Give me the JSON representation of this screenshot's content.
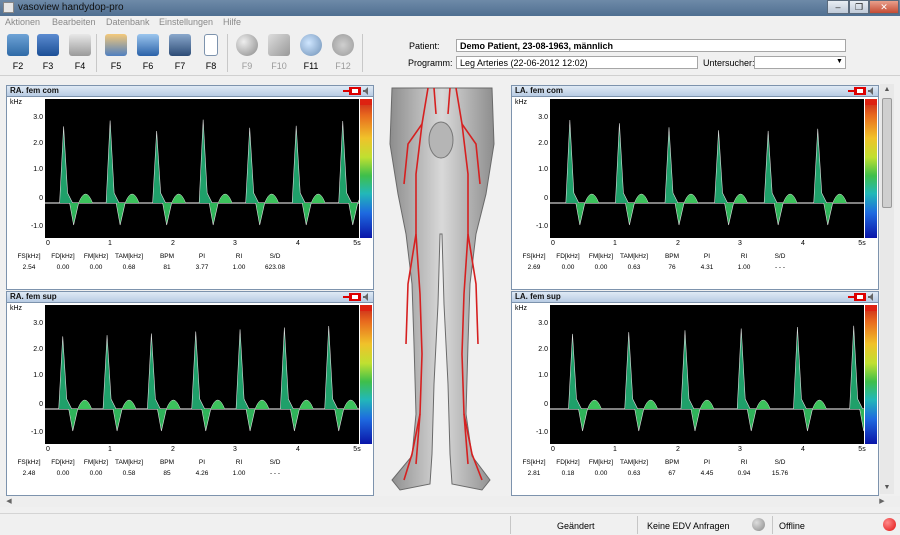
{
  "window": {
    "title": "vasoview handydop-pro",
    "min": "–",
    "max": "❐",
    "close": "✕"
  },
  "menu": [
    "Aktionen",
    "Bearbeiten",
    "Datenbank",
    "Einstellungen",
    "Hilfe"
  ],
  "toolbar": {
    "buttons": [
      {
        "label": "F2",
        "icon": "open-folder-icon",
        "enabled": true
      },
      {
        "label": "F3",
        "icon": "save-disk-icon",
        "enabled": true
      },
      {
        "label": "F4",
        "icon": "printer-icon",
        "enabled": true
      },
      {
        "label": "F5",
        "icon": "patient-icon",
        "enabled": true
      },
      {
        "label": "F6",
        "icon": "edit-record-icon",
        "enabled": true
      },
      {
        "label": "F7",
        "icon": "monitor-icon",
        "enabled": true
      },
      {
        "label": "F8",
        "icon": "document-icon",
        "enabled": true
      },
      {
        "label": "F9",
        "icon": "record-sphere-icon",
        "enabled": false
      },
      {
        "label": "F10",
        "icon": "probe-icon",
        "enabled": false
      },
      {
        "label": "F11",
        "icon": "zoom-icon",
        "enabled": true
      },
      {
        "label": "F12",
        "icon": "speaker-icon",
        "enabled": false
      }
    ],
    "patient_label": "Patient:",
    "patient_value": "Demo Patient, 23-08-1963, männlich",
    "program_label": "Programm:",
    "program_value": "Leg Arteries (22-06-2012 12:02)",
    "examiner_label": "Untersucher:",
    "examiner_value": ""
  },
  "panels": [
    {
      "title": "RA. fem com",
      "values": [
        "2.54",
        "0.00",
        "0.00",
        "0.68",
        "81",
        "3.77",
        "1.00",
        "623.08"
      ]
    },
    {
      "title": "LA. fem com",
      "values": [
        "2.69",
        "0.00",
        "0.00",
        "0.63",
        "76",
        "4.31",
        "1.00",
        "- - -"
      ]
    },
    {
      "title": "RA. fem sup",
      "values": [
        "2.48",
        "0.00",
        "0.00",
        "0.58",
        "85",
        "4.26",
        "1.00",
        "- - -"
      ]
    },
    {
      "title": "LA. fem sup",
      "values": [
        "2.81",
        "0.18",
        "0.00",
        "0.63",
        "67",
        "4.45",
        "0.94",
        "15.76"
      ]
    }
  ],
  "measure_headers": [
    "FS[kHz]",
    "FD[kHz]",
    "FM[kHz]",
    "TAM[kHz]",
    "BPM",
    "PI",
    "RI",
    "S/D"
  ],
  "y_unit": "kHz",
  "y_ticks": [
    "3.0",
    "2.0",
    "1.0",
    "0",
    "-1.0"
  ],
  "x_ticks": [
    "0",
    "1",
    "2",
    "3",
    "4",
    "5s"
  ],
  "status": {
    "changed": "Geändert",
    "edv": "Keine EDV Anfragen",
    "connection": "Offline",
    "colors": {
      "neutral_led": "#8a8a8a",
      "offline_led": "#e01010"
    }
  }
}
